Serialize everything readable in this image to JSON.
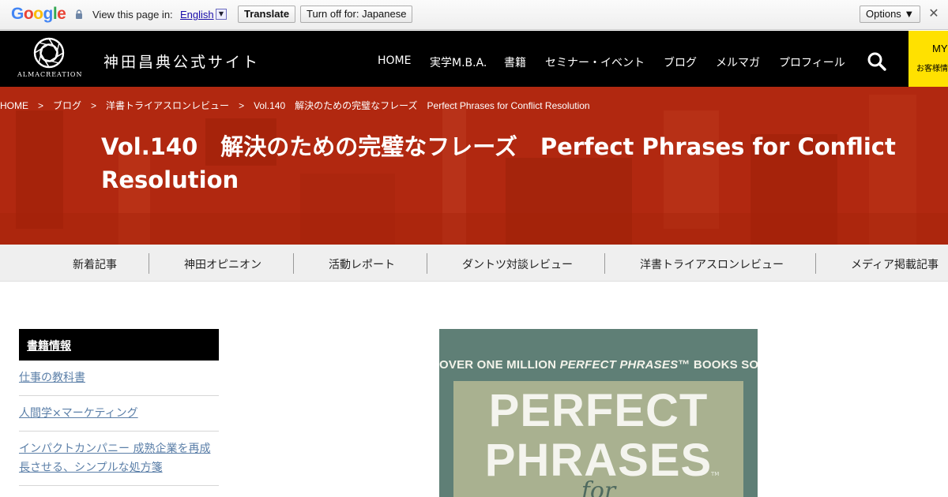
{
  "translate_bar": {
    "logo_letters": [
      {
        "ch": "G",
        "color": "#4285F4"
      },
      {
        "ch": "o",
        "color": "#EA4335"
      },
      {
        "ch": "o",
        "color": "#FBBC05"
      },
      {
        "ch": "g",
        "color": "#4285F4"
      },
      {
        "ch": "l",
        "color": "#34A853"
      },
      {
        "ch": "e",
        "color": "#EA4335"
      }
    ],
    "view_text": "View this page in:",
    "language": "English",
    "translate_button": "Translate",
    "turn_off_button": "Turn off for: Japanese",
    "options_button": "Options ▼",
    "close_glyph": "✕"
  },
  "header": {
    "logo_text": "ALMACREATION",
    "site_title": "神田昌典公式サイト",
    "nav": [
      "HOME",
      "実学M.B.A.",
      "書籍",
      "セミナー・イベント",
      "ブログ",
      "メルマガ",
      "プロフィール"
    ],
    "my_box": {
      "title": "MY",
      "sub": "お客様情報"
    }
  },
  "hero": {
    "breadcrumb": [
      "HOME",
      "ブログ",
      "洋書トライアスロンレビュー",
      "Vol.140　解決のための完璧なフレーズ　Perfect Phrases for Conflict Resolution"
    ],
    "breadcrumb_sep": ">",
    "title": "Vol.140　解決のための完璧なフレーズ　Perfect Phrases for Conflict Resolution"
  },
  "categories": [
    "新着記事",
    "神田オピニオン",
    "活動レポート",
    "ダントツ対談レビュー",
    "洋書トライアスロンレビュー",
    "メディア掲載記事"
  ],
  "sidebar": {
    "heading": "書籍情報",
    "links": [
      "仕事の教科書",
      "人間学×マーケティング",
      "インパクトカンパニー 成熟企業を再成長させる、シンプルな処方箋"
    ]
  },
  "book": {
    "banner_pre": "OVER ONE MILLION ",
    "banner_em": "PERFECT PHRASES",
    "banner_tm": "™",
    "banner_post": " BOOKS SOLD",
    "line1": "PERFECT",
    "line2": "PHRASES",
    "tm": "TM",
    "for_text": "for"
  },
  "colors": {
    "header_bg": "#000000",
    "hero_red": "#b12810",
    "my_yellow": "#ffe100",
    "sidebar_link": "#5b7fa8",
    "book_green": "#5f7f76"
  }
}
